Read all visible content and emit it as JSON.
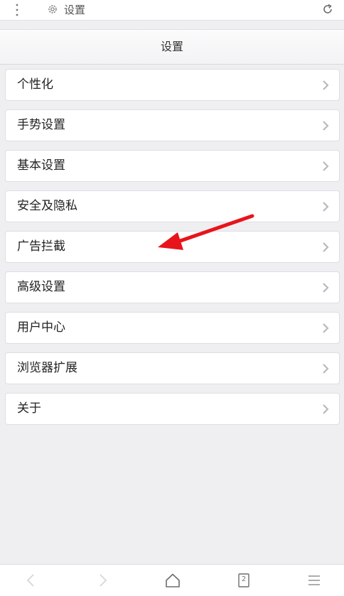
{
  "status_bar": {
    "title": "设置",
    "icons": [
      "more-vertical-icon",
      "gear-icon",
      "reload-icon"
    ]
  },
  "header": {
    "title": "设置"
  },
  "menu": {
    "items": [
      {
        "label": "个性化"
      },
      {
        "label": "手势设置"
      },
      {
        "label": "基本设置"
      },
      {
        "label": "安全及隐私"
      },
      {
        "label": "广告拦截"
      },
      {
        "label": "高级设置"
      },
      {
        "label": "用户中心"
      },
      {
        "label": "浏览器扩展"
      },
      {
        "label": "关于"
      }
    ]
  },
  "toolbar": {
    "tab_count": "2",
    "icons": [
      "back-icon",
      "forward-icon",
      "home-icon",
      "tabs-icon",
      "menu-icon"
    ]
  },
  "colors": {
    "background": "#efeff2",
    "annotation_arrow": "#e8141b",
    "chevron": "#b9b9be"
  }
}
